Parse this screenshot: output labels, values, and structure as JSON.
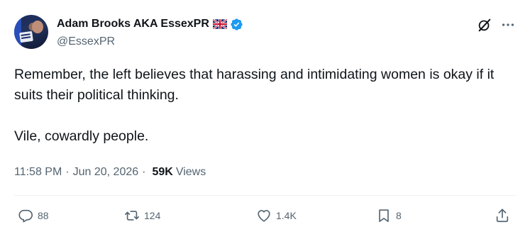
{
  "author": {
    "name": "Adam Brooks AKA EssexPR",
    "handle": "@EssexPR"
  },
  "tweet": {
    "paragraphs": [
      "Remember, the left believes that harassing and intimidating women is okay if it suits their political thinking.",
      "Vile, cowardly people."
    ]
  },
  "meta": {
    "time": "11:58 PM",
    "separator": "·",
    "date": "Jun 20, 2026",
    "separator2": "·",
    "views_count": "59K",
    "views_label": "Views"
  },
  "actions": {
    "replies": "88",
    "reposts": "124",
    "likes": "1.4K",
    "bookmarks": "8"
  },
  "colors": {
    "text": "#0f1419",
    "secondary": "#536471",
    "verified": "#1d9bf0",
    "divider": "#eff3f4"
  },
  "icons": [
    "uk-flag-icon",
    "verified-badge-icon",
    "grok-icon",
    "more-icon",
    "reply-icon",
    "repost-icon",
    "like-icon",
    "bookmark-icon",
    "share-icon"
  ]
}
